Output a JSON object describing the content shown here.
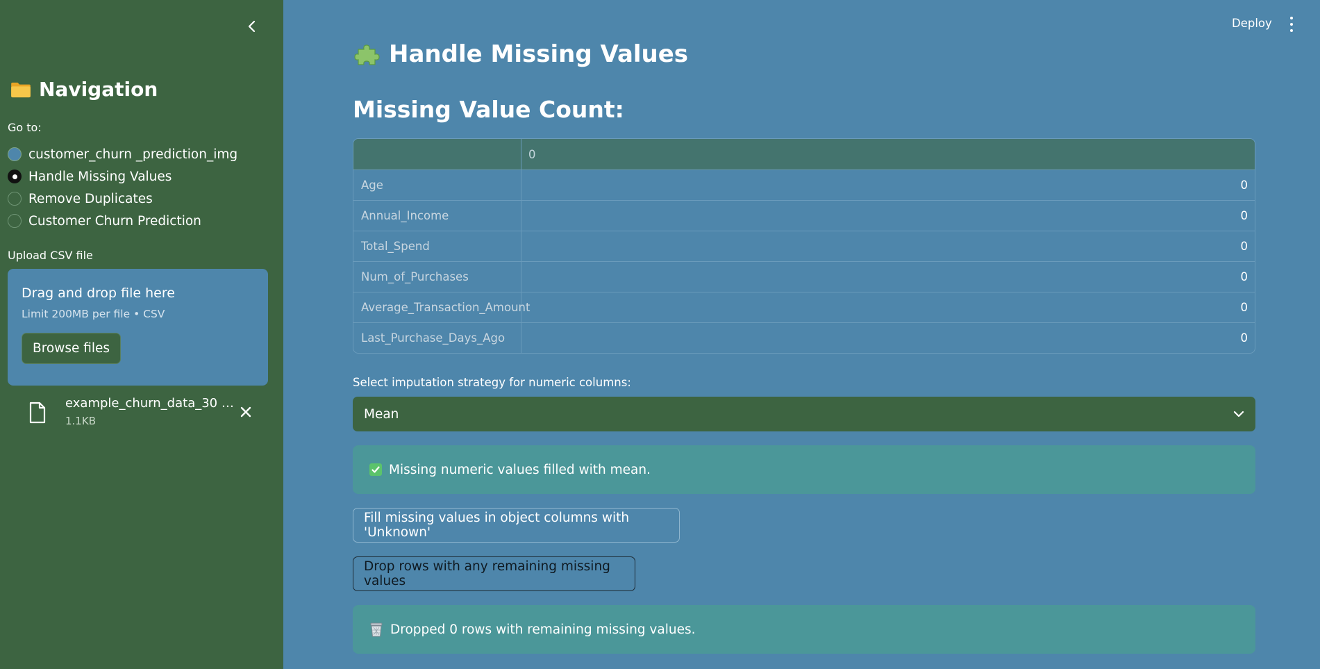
{
  "sidebar": {
    "title": "Navigation",
    "goto_label": "Go to:",
    "radio_options": [
      {
        "label": "customer_churn _prediction_img",
        "state": "unchecked"
      },
      {
        "label": "Handle Missing Values",
        "state": "checked"
      },
      {
        "label": "Remove Duplicates",
        "state": "unchecked"
      },
      {
        "label": "Customer Churn Prediction",
        "state": "unchecked"
      }
    ],
    "upload": {
      "label": "Upload CSV file",
      "drop_title": "Drag and drop file here",
      "drop_subtitle": "Limit 200MB per file • CSV",
      "browse_label": "Browse files"
    },
    "file": {
      "name": "example_churn_data_30 n…",
      "size": "1.1KB"
    }
  },
  "header": {
    "deploy_label": "Deploy"
  },
  "main": {
    "page_title": "Handle Missing Values",
    "section_title": "Missing Value Count:",
    "table": {
      "column_header": "0",
      "rows": [
        {
          "name": "Age",
          "value": "0"
        },
        {
          "name": "Annual_Income",
          "value": "0"
        },
        {
          "name": "Total_Spend",
          "value": "0"
        },
        {
          "name": "Num_of_Purchases",
          "value": "0"
        },
        {
          "name": "Average_Transaction_Amount",
          "value": "0"
        },
        {
          "name": "Last_Purchase_Days_Ago",
          "value": "0"
        }
      ]
    },
    "select_label": "Select imputation strategy for numeric columns:",
    "select_value": "Mean",
    "alert_filled": "Missing numeric values filled with mean.",
    "btn_fill_object": "Fill missing values in object columns with 'Unknown'",
    "btn_drop_rows": "Drop rows with any remaining missing values",
    "alert_dropped": "Dropped 0 rows with remaining missing values."
  },
  "colors": {
    "sidebar_bg": "#3d6441",
    "main_bg": "#4e86ab",
    "alert_bg": "#4b9799",
    "table_header_bg": "#44746e"
  }
}
